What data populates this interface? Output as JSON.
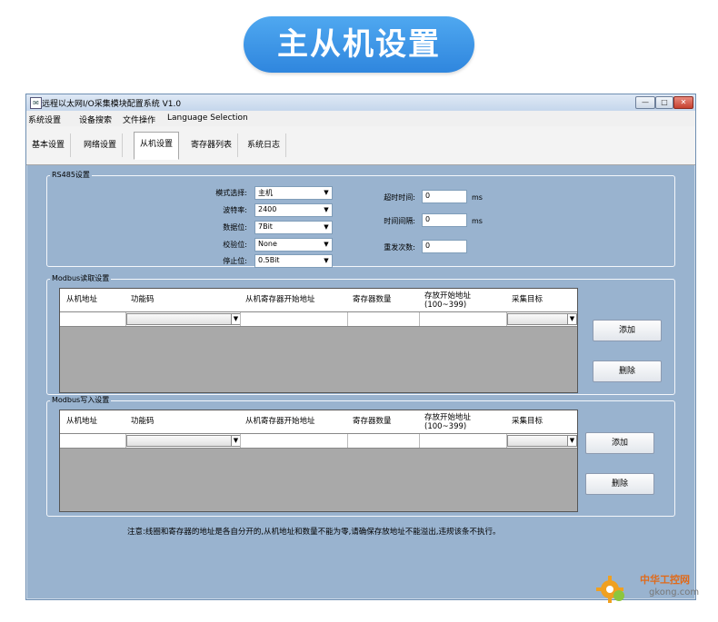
{
  "banner": {
    "title": "主从机设置"
  },
  "window": {
    "title": "远程以太网I/O采集模块配置系统 V1.0",
    "controls": {
      "minimize": "—",
      "maximize": "□",
      "close": "✕"
    }
  },
  "menu": [
    "系统设置",
    "设备搜索",
    "文件操作",
    "Language Selection"
  ],
  "tabs": [
    "基本设置",
    "网络设置",
    "从机设置",
    "寄存器列表",
    "系统日志"
  ],
  "active_tab": "从机设置",
  "rs485": {
    "title": "RS485设置",
    "mode_label": "模式选择:",
    "mode_value": "主机",
    "baud_label": "波特率:",
    "baud_value": "2400",
    "databits_label": "数据位:",
    "databits_value": "7Bit",
    "parity_label": "校验位:",
    "parity_value": "None",
    "stopbits_label": "停止位:",
    "stopbits_value": "0.5Bit",
    "timeout_label": "超时时间:",
    "timeout_value": "0",
    "timeout_unit": "ms",
    "interval_label": "时间间隔:",
    "interval_value": "0",
    "interval_unit": "ms",
    "retry_label": "重发次数:",
    "retry_value": "0"
  },
  "modbus_read": {
    "title": "Modbus读取设置",
    "columns": [
      "从机地址",
      "功能码",
      "从机寄存器开始地址",
      "寄存器数量",
      "存放开始地址\n(100~399)",
      "采集目标"
    ],
    "add_label": "添加",
    "delete_label": "删除"
  },
  "modbus_write": {
    "title": "Modbus写入设置",
    "columns": [
      "从机地址",
      "功能码",
      "从机寄存器开始地址",
      "寄存器数量",
      "存放开始地址\n(100~399)",
      "采集目标"
    ],
    "add_label": "添加",
    "delete_label": "删除"
  },
  "note": "注意:线圈和寄存器的地址是各自分开的,从机地址和数量不能为零,请确保存放地址不能溢出,违规该条不执行。",
  "watermark": {
    "cn": "中华工控网",
    "en": "gkong.com"
  }
}
